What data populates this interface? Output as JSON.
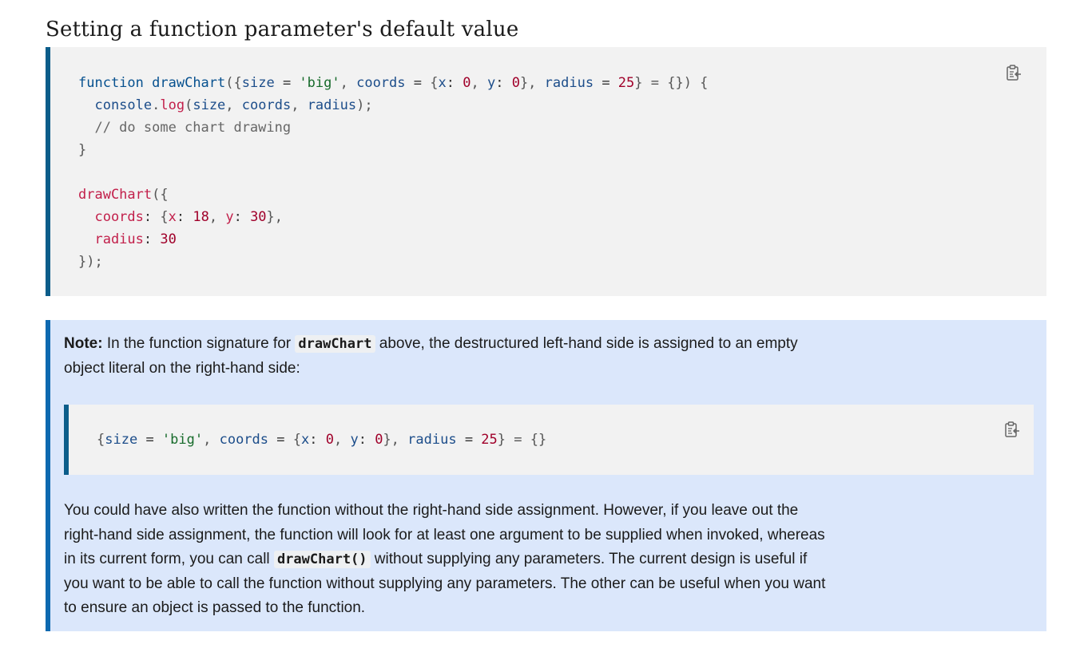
{
  "heading": "Setting a function parameter's default value",
  "code_block_1": {
    "lines": [
      [
        {
          "t": "function",
          "c": "kw"
        },
        {
          "t": " ",
          "c": "plain"
        },
        {
          "t": "drawChart",
          "c": "kw"
        },
        {
          "t": "({",
          "c": "punc"
        },
        {
          "t": "size",
          "c": "prop"
        },
        {
          "t": " = ",
          "c": "plain"
        },
        {
          "t": "'big'",
          "c": "str"
        },
        {
          "t": ", ",
          "c": "punc"
        },
        {
          "t": "coords",
          "c": "prop"
        },
        {
          "t": " = ",
          "c": "plain"
        },
        {
          "t": "{",
          "c": "punc"
        },
        {
          "t": "x",
          "c": "prop"
        },
        {
          "t": ": ",
          "c": "plain"
        },
        {
          "t": "0",
          "c": "num"
        },
        {
          "t": ", ",
          "c": "punc"
        },
        {
          "t": "y",
          "c": "prop"
        },
        {
          "t": ": ",
          "c": "plain"
        },
        {
          "t": "0",
          "c": "num"
        },
        {
          "t": "}, ",
          "c": "punc"
        },
        {
          "t": "radius",
          "c": "prop"
        },
        {
          "t": " = ",
          "c": "plain"
        },
        {
          "t": "25",
          "c": "num"
        },
        {
          "t": "} = {}) {",
          "c": "punc"
        }
      ],
      [
        {
          "t": "  console",
          "c": "prop"
        },
        {
          "t": ".",
          "c": "punc"
        },
        {
          "t": "log",
          "c": "fn"
        },
        {
          "t": "(",
          "c": "punc"
        },
        {
          "t": "size",
          "c": "prop"
        },
        {
          "t": ", ",
          "c": "punc"
        },
        {
          "t": "coords",
          "c": "prop"
        },
        {
          "t": ", ",
          "c": "punc"
        },
        {
          "t": "radius",
          "c": "prop"
        },
        {
          "t": ");",
          "c": "punc"
        }
      ],
      [
        {
          "t": "  // do some chart drawing",
          "c": "com"
        }
      ],
      [
        {
          "t": "}",
          "c": "punc"
        }
      ],
      [
        {
          "t": "",
          "c": "plain"
        }
      ],
      [
        {
          "t": "drawChart",
          "c": "fn"
        },
        {
          "t": "({",
          "c": "punc"
        }
      ],
      [
        {
          "t": "  coords",
          "c": "fn"
        },
        {
          "t": ": ",
          "c": "plain"
        },
        {
          "t": "{",
          "c": "punc"
        },
        {
          "t": "x",
          "c": "fn"
        },
        {
          "t": ": ",
          "c": "plain"
        },
        {
          "t": "18",
          "c": "num"
        },
        {
          "t": ", ",
          "c": "punc"
        },
        {
          "t": "y",
          "c": "fn"
        },
        {
          "t": ": ",
          "c": "plain"
        },
        {
          "t": "30",
          "c": "num"
        },
        {
          "t": "},",
          "c": "punc"
        }
      ],
      [
        {
          "t": "  radius",
          "c": "fn"
        },
        {
          "t": ": ",
          "c": "plain"
        },
        {
          "t": "30",
          "c": "num"
        }
      ],
      [
        {
          "t": "});",
          "c": "punc"
        }
      ]
    ]
  },
  "note": {
    "label": "Note:",
    "p1_before": " In the function signature for ",
    "p1_code": "drawChart",
    "p1_after": " above, the destructured left-hand side is assigned to an empty object literal on the right-hand side:",
    "code_block_2": {
      "lines": [
        [
          {
            "t": "{",
            "c": "punc"
          },
          {
            "t": "size",
            "c": "prop"
          },
          {
            "t": " = ",
            "c": "plain"
          },
          {
            "t": "'big'",
            "c": "str"
          },
          {
            "t": ", ",
            "c": "punc"
          },
          {
            "t": "coords",
            "c": "prop"
          },
          {
            "t": " = ",
            "c": "plain"
          },
          {
            "t": "{",
            "c": "punc"
          },
          {
            "t": "x",
            "c": "prop"
          },
          {
            "t": ": ",
            "c": "plain"
          },
          {
            "t": "0",
            "c": "num"
          },
          {
            "t": ", ",
            "c": "punc"
          },
          {
            "t": "y",
            "c": "prop"
          },
          {
            "t": ": ",
            "c": "plain"
          },
          {
            "t": "0",
            "c": "num"
          },
          {
            "t": "}, ",
            "c": "punc"
          },
          {
            "t": "radius",
            "c": "prop"
          },
          {
            "t": " = ",
            "c": "plain"
          },
          {
            "t": "25",
            "c": "num"
          },
          {
            "t": "} = {}",
            "c": "punc"
          }
        ]
      ]
    },
    "p2_before": "You could have also written the function without the right-hand side assignment. However, if you leave out the right-hand side assignment, the function will look for at least one argument to be supplied when invoked, whereas in its current form, you can call ",
    "p2_code": "drawChart()",
    "p2_after": " without supplying any parameters. The current design is useful if you want to be able to call the function without supplying any parameters. The other can be useful when you want to ensure an object is passed to the function."
  },
  "icons": {
    "copy": "clipboard-copy-icon"
  },
  "colors": {
    "code_bg": "#f2f2f2",
    "code_border": "#0b5d8a",
    "note_bg": "#dbe7fb",
    "note_border": "#0d69b0"
  }
}
